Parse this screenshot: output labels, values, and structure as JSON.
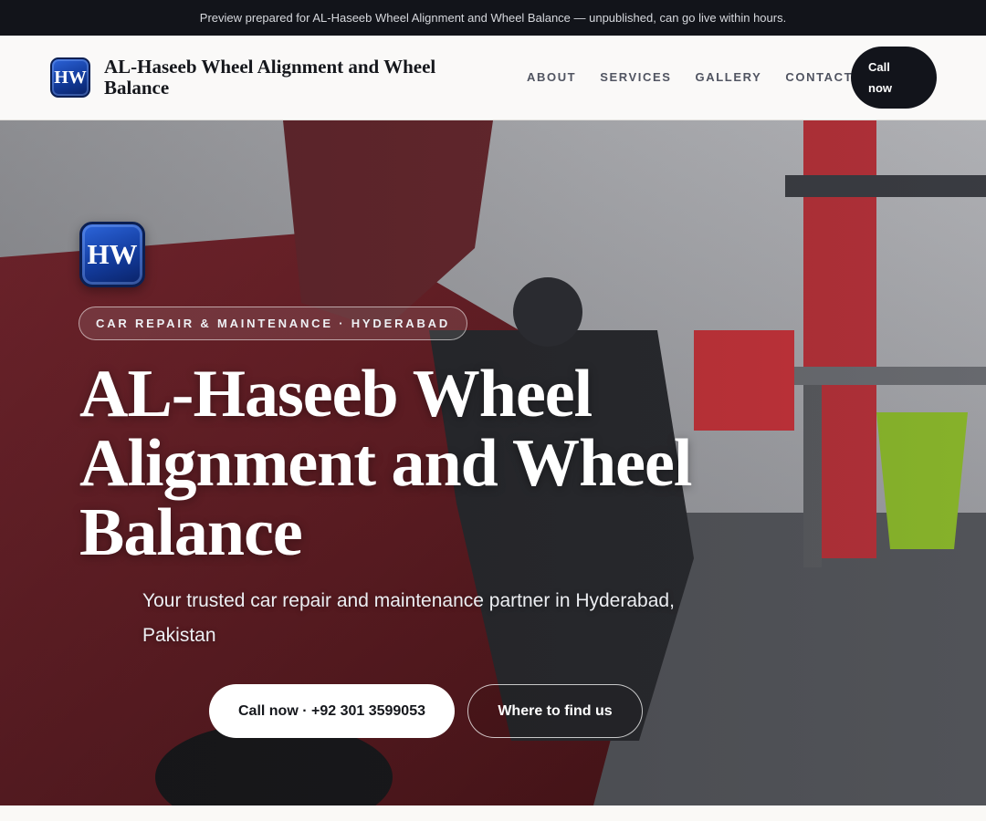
{
  "banner": {
    "text": "Preview prepared for AL-Haseeb Wheel Alignment and Wheel Balance — unpublished, can go live within hours."
  },
  "header": {
    "logo_text": "HW",
    "brand": "AL-Haseeb Wheel Alignment and Wheel Balance",
    "nav": [
      {
        "label": "ABOUT"
      },
      {
        "label": "SERVICES"
      },
      {
        "label": "GALLERY"
      },
      {
        "label": "CONTACT"
      }
    ],
    "call_label": "Call now"
  },
  "hero": {
    "logo_text": "HW",
    "badge": "CAR REPAIR & MAINTENANCE · HYDERABAD",
    "title": "AL-Haseeb Wheel Alignment and Wheel Balance",
    "subtitle": "Your trusted car repair and maintenance partner in Hyderabad, Pakistan",
    "call_button": "Call now · +92 301 3599053",
    "find_button": "Where to find us"
  },
  "colors": {
    "banner_bg": "#12141a",
    "dark_button": "#12141b",
    "logo_blue": "#133c9e"
  }
}
